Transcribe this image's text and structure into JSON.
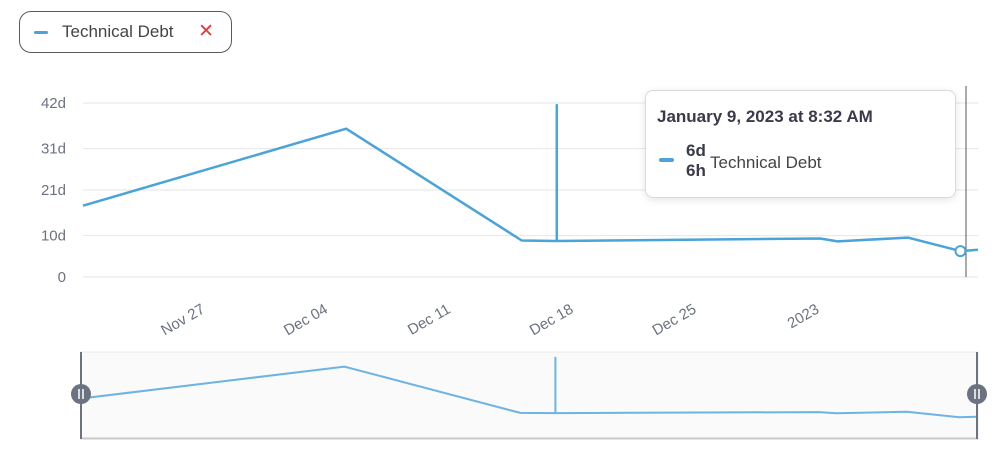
{
  "legend": {
    "label": "Technical Debt",
    "close_glyph": "✕",
    "close_icon": "close-icon"
  },
  "tooltip": {
    "title": "January 9, 2023 at 8:32 AM",
    "value": "6d 6h",
    "series": "Technical Debt"
  },
  "colors": {
    "series": "#4aa3d9",
    "navigator_line": "#6db3e3",
    "handle": "#6b7280",
    "grid": "#e6e6e6",
    "close": "#e03a3a"
  },
  "chart_data": {
    "type": "line",
    "title": "",
    "xlabel": "",
    "ylabel": "",
    "y_unit": "days",
    "ylim": [
      0,
      42
    ],
    "y_ticks": [
      0,
      10,
      21,
      31,
      42
    ],
    "y_tick_labels": [
      "0",
      "10d",
      "21d",
      "31d",
      "42d"
    ],
    "x_range": [
      "2022-11-20",
      "2023-01-10"
    ],
    "x_ticks": [
      "2022-11-27",
      "2022-12-04",
      "2022-12-11",
      "2022-12-18",
      "2022-12-25",
      "2023-01-01"
    ],
    "x_tick_labels": [
      "Nov 27",
      "Dec 04",
      "Dec 11",
      "Dec 18",
      "Dec 25",
      "2023"
    ],
    "grid": true,
    "series": [
      {
        "name": "Technical Debt",
        "points": [
          [
            "2022-11-20",
            17.2
          ],
          [
            "2022-12-05",
            35.8
          ],
          [
            "2022-12-15",
            8.8
          ],
          [
            "2022-12-17",
            8.7
          ],
          [
            "2022-12-17",
            41.5
          ],
          [
            "2022-12-17",
            8.7
          ],
          [
            "2023-01-01",
            9.3
          ],
          [
            "2023-01-02",
            8.6
          ],
          [
            "2023-01-06",
            9.5
          ],
          [
            "2023-01-09",
            6.25
          ],
          [
            "2023-01-10",
            6.6
          ]
        ]
      }
    ],
    "highlight": {
      "x": "2023-01-09",
      "y": 6.25
    }
  }
}
